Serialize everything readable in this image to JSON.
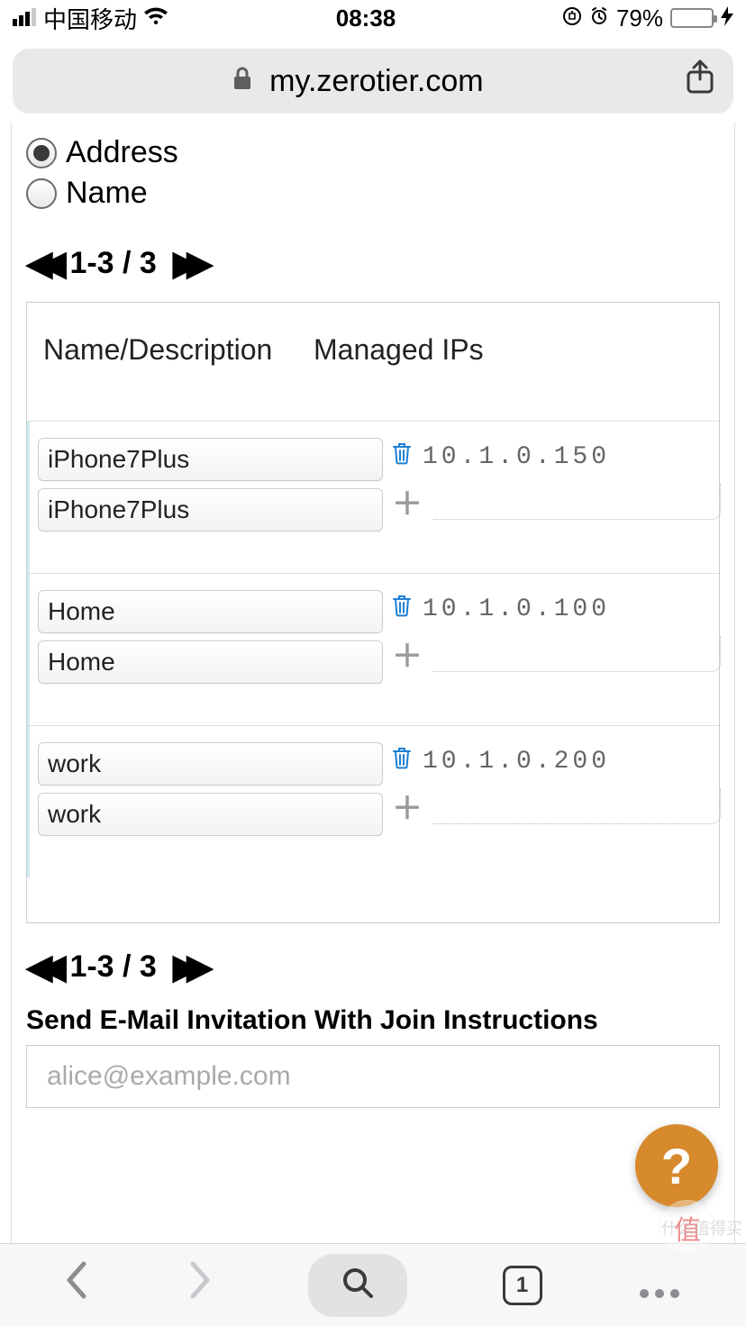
{
  "status": {
    "carrier": "中国移动",
    "time": "08:38",
    "battery_pct": "79%"
  },
  "addressbar": {
    "url": "my.zerotier.com"
  },
  "sort": {
    "option_address": "Address",
    "option_name": "Name"
  },
  "pager": {
    "range": "1-3 / 3"
  },
  "table": {
    "header_name": "Name/Description",
    "header_ips": "Managed IPs",
    "rows": [
      {
        "name": "iPhone7Plus",
        "desc": "iPhone7Plus",
        "ip": "10.1.0.150"
      },
      {
        "name": "Home",
        "desc": "Home",
        "ip": "10.1.0.100"
      },
      {
        "name": "work",
        "desc": "work",
        "ip": "10.1.0.200"
      }
    ]
  },
  "invite": {
    "title": "Send E-Mail Invitation With Join Instructions",
    "placeholder": "alice@example.com"
  },
  "help": {
    "label": "?"
  },
  "browser": {
    "tab_count": "1"
  },
  "watermark": {
    "text": "什么值得买"
  }
}
